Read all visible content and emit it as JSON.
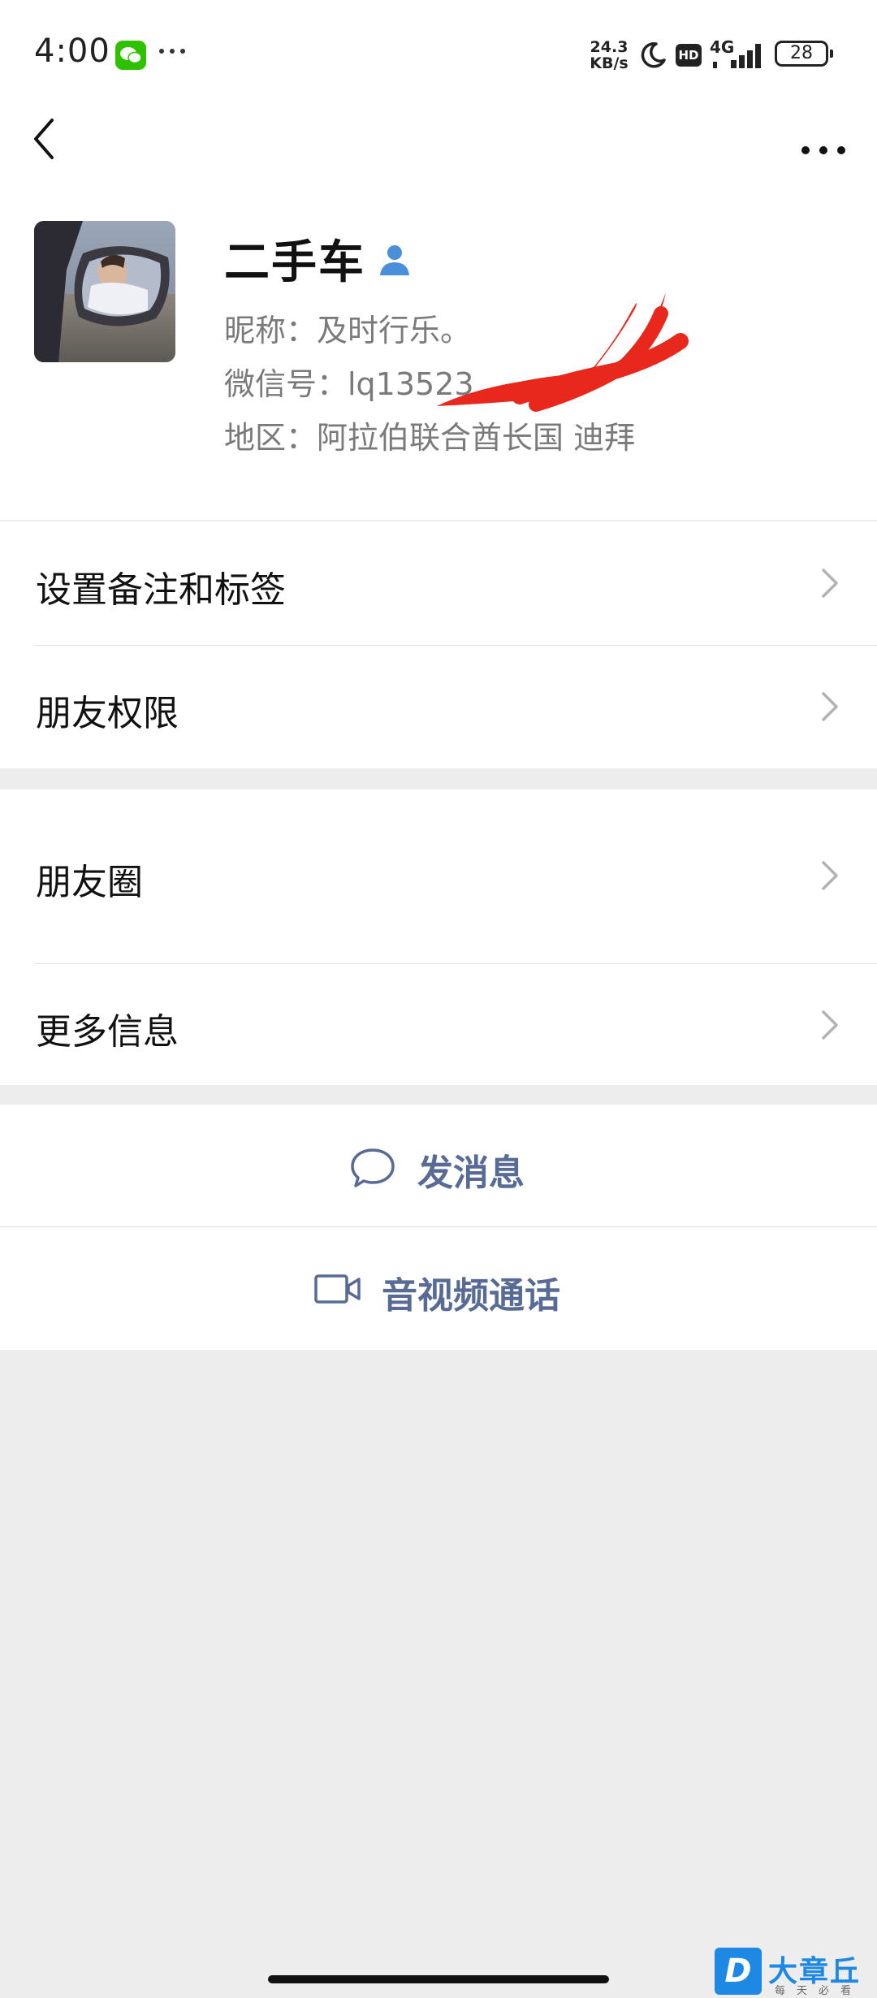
{
  "status_bar": {
    "time": "4:00",
    "net_speed_value": "24.3",
    "net_speed_unit": "KB/s",
    "hd_label": "HD",
    "network": "4G",
    "battery": "28",
    "icons": [
      "wechat-notification-icon",
      "more-notifications-icon",
      "do-not-disturb-moon-icon",
      "hd-icon",
      "signal-icon",
      "battery-icon"
    ]
  },
  "nav": {
    "back_icon": "chevron-left-icon",
    "more_icon": "more-dots-icon"
  },
  "profile": {
    "name": "二手车",
    "nickname": "昵称：及时行乐。",
    "wechat_id": "微信号：lq13523",
    "region": "地区：阿拉伯联合酋长国  迪拜"
  },
  "menu_section_1": [
    {
      "label": "设置备注和标签"
    },
    {
      "label": "朋友权限"
    }
  ],
  "menu_section_2": [
    {
      "label": "朋友圈"
    },
    {
      "label": "更多信息"
    }
  ],
  "actions": {
    "message": "发消息",
    "video_call": "音视频通话"
  },
  "watermark": {
    "logo_letter": "D",
    "title": "大章丘",
    "subtitle": "每天必看"
  },
  "colors": {
    "link_blue": "#576b95",
    "page_background": "#ededed",
    "wechat_green": "#2dc100",
    "verified_blue": "#4a90d9",
    "scribble_red": "#e8281d"
  }
}
